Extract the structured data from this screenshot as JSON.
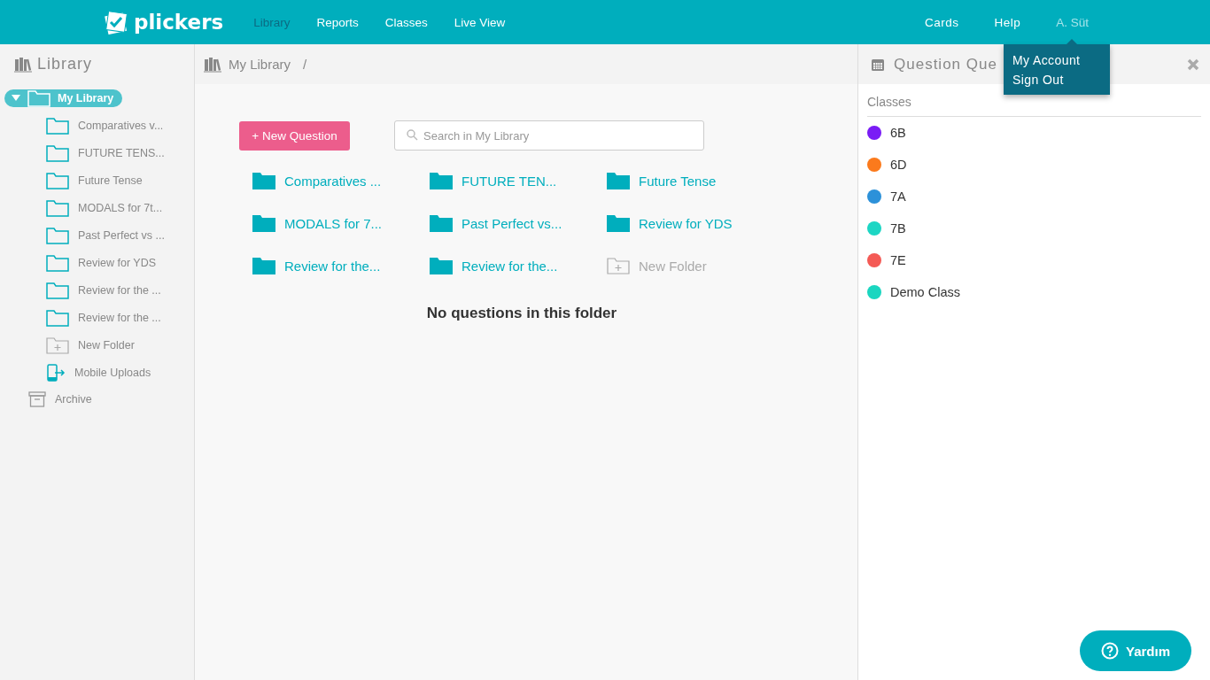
{
  "topbar": {
    "logo": "plickers",
    "nav": [
      {
        "label": "Library",
        "selected": true
      },
      {
        "label": "Reports",
        "selected": false
      },
      {
        "label": "Classes",
        "selected": false
      },
      {
        "label": "Live View",
        "selected": false
      }
    ],
    "right_nav": [
      "Cards",
      "Help"
    ],
    "user": "A. Süt",
    "user_menu": {
      "open": true,
      "items": [
        "My Account",
        "Sign Out"
      ]
    }
  },
  "sidebar": {
    "title": "Library",
    "tree": [
      {
        "label": "My Library",
        "kind": "folder",
        "selected": true,
        "expanded": true,
        "children": [
          {
            "label": "Comparatives v...",
            "kind": "folder"
          },
          {
            "label": "FUTURE TENS...",
            "kind": "folder"
          },
          {
            "label": "Future Tense",
            "kind": "folder"
          },
          {
            "label": "MODALS for 7t...",
            "kind": "folder"
          },
          {
            "label": "Past Perfect vs ...",
            "kind": "folder"
          },
          {
            "label": "Review for YDS",
            "kind": "folder"
          },
          {
            "label": "Review for the ...",
            "kind": "folder"
          },
          {
            "label": "Review for the ...",
            "kind": "folder"
          },
          {
            "label": "New Folder",
            "kind": "new-folder"
          },
          {
            "label": "Mobile Uploads",
            "kind": "mobile"
          }
        ]
      },
      {
        "label": "Archive",
        "kind": "archive",
        "selected": false
      }
    ]
  },
  "main": {
    "breadcrumb": [
      "My Library",
      "/"
    ],
    "new_button": "+ New Question",
    "search": {
      "placeholder": "Search in My Library"
    },
    "folders": [
      {
        "label": "Comparatives ...",
        "kind": "folder"
      },
      {
        "label": "FUTURE TEN...",
        "kind": "folder"
      },
      {
        "label": "Future Tense",
        "kind": "folder"
      },
      {
        "label": "MODALS for 7...",
        "kind": "folder"
      },
      {
        "label": "Past Perfect vs...",
        "kind": "folder"
      },
      {
        "label": "Review for YDS",
        "kind": "folder"
      },
      {
        "label": "Review for the...",
        "kind": "folder"
      },
      {
        "label": "Review for the...",
        "kind": "folder"
      },
      {
        "label": "New Folder",
        "kind": "new-folder"
      }
    ],
    "empty_message": "No questions in this folder"
  },
  "queue": {
    "title": "Question Que",
    "section": "Classes",
    "classes": [
      {
        "name": "6B",
        "color": "#7a1cf5"
      },
      {
        "name": "6D",
        "color": "#fb7a1c"
      },
      {
        "name": "7A",
        "color": "#2c91d9"
      },
      {
        "name": "7B",
        "color": "#1dd6c4"
      },
      {
        "name": "7E",
        "color": "#f45a55"
      },
      {
        "name": "Demo Class",
        "color": "#1ad6c0"
      }
    ]
  },
  "help_button": "Yardım"
}
